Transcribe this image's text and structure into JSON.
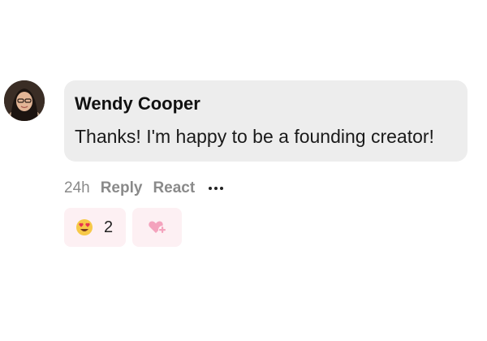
{
  "comment": {
    "author": "Wendy Cooper",
    "text": "Thanks! I'm happy to be a founding creator!",
    "timestamp": "24h",
    "actions": {
      "reply_label": "Reply",
      "react_label": "React"
    },
    "reactions": [
      {
        "emoji": "heart-eyes-icon",
        "count": "2"
      }
    ]
  },
  "colors": {
    "bubble": "#ededed",
    "meta_text": "#8a8a8a",
    "reaction_chip": "#fdf0f3",
    "add_reaction_icon": "#f4a3bd"
  }
}
